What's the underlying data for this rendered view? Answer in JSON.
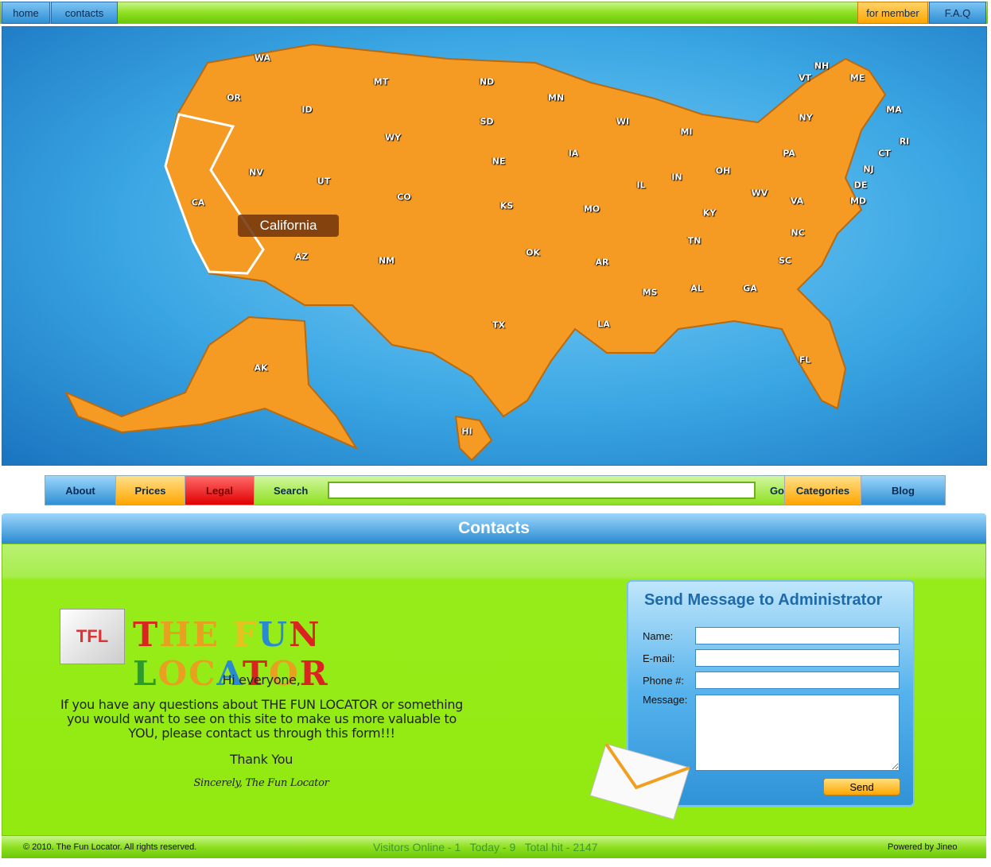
{
  "top_nav": {
    "left": [
      "home",
      "contacts"
    ],
    "right": [
      "for member",
      "F.A.Q"
    ]
  },
  "map": {
    "tooltip": "California",
    "states": [
      "WA",
      "OR",
      "ID",
      "MT",
      "ND",
      "MN",
      "WY",
      "SD",
      "NV",
      "UT",
      "CO",
      "NE",
      "KS",
      "IA",
      "WI",
      "MI",
      "IL",
      "IN",
      "OH",
      "MO",
      "CA",
      "AZ",
      "NM",
      "OK",
      "AR",
      "TN",
      "KY",
      "WV",
      "VA",
      "PA",
      "NY",
      "VT",
      "NH",
      "ME",
      "MA",
      "RI",
      "CT",
      "NJ",
      "DE",
      "MD",
      "NC",
      "SC",
      "GA",
      "AL",
      "MS",
      "LA",
      "TX",
      "FL",
      "AK",
      "HI"
    ],
    "colors": {
      "land": "#f59a23",
      "water": "#3aa6e3"
    }
  },
  "menu": {
    "about": "About",
    "prices": "Prices",
    "legal": "Legal",
    "search": "Search",
    "search_value": "",
    "go": "Go",
    "categories": "Categories",
    "blog": "Blog"
  },
  "contacts": {
    "title": "Contacts",
    "logo_text": "TFL THE FUN LOCATOR",
    "greeting": "Hi everyone,",
    "body": "If you have any questions about THE FUN LOCATOR or something you would want to see on this site to make us more valuable to YOU, please contact us through this form!!!",
    "thanks": "Thank You",
    "signature": "Sincerely, The Fun Locator"
  },
  "form": {
    "title": "Send Message to Administrator",
    "name": "Name:",
    "email": "E-mail:",
    "phone": "Phone #:",
    "message": "Message:",
    "send": "Send"
  },
  "footer": {
    "copyright": "© 2010. The Fun Locator. All rights reserved.",
    "stats": "Visitors Online - 1   Today - 9   Total hit - 2147",
    "powered": "Powered by Jineo"
  }
}
